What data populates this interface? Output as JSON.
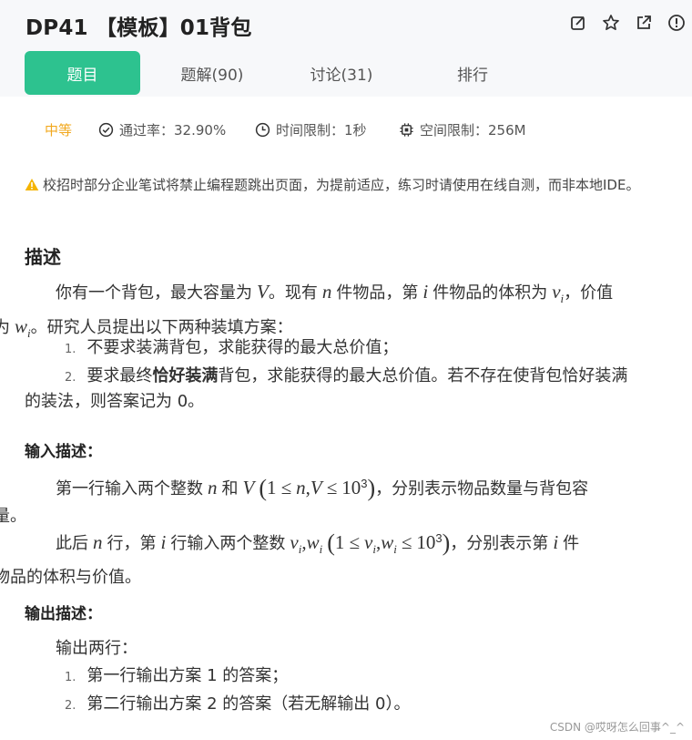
{
  "header": {
    "title": "DP41 【模板】01背包",
    "icons": [
      "edit-icon",
      "star-icon",
      "share-icon",
      "report-icon"
    ]
  },
  "tabs": [
    {
      "label": "题目",
      "active": true
    },
    {
      "label": "题解(90)",
      "active": false
    },
    {
      "label": "讨论(31)",
      "active": false
    },
    {
      "label": "排行",
      "active": false
    }
  ],
  "stats": {
    "difficulty": "中等",
    "pass_rate": "通过率：32.90%",
    "time_limit": "时间限制：1秒",
    "memory_limit": "空间限制：256M"
  },
  "colors": {
    "accent": "#2dc28f",
    "difficulty": "#f2a81d",
    "warn": "#f5b400"
  },
  "warning": "校招时部分企业笔试将禁止编程题跳出页面，为提前适应，练习时请使用在线自测，而非本地IDE。",
  "description": {
    "heading": "描述",
    "p1a": "你有一个背包，最大容量为 ",
    "var_V": "V",
    "p1b": "。现有 ",
    "var_n": "n",
    "p1c": " 件物品，第 ",
    "var_i": "i",
    "p1d": " 件物品的体积为 ",
    "var_vi": "v",
    "p1e": "，价值",
    "p1f": "为 ",
    "var_wi": "w",
    "p1g": "。研究人员提出以下两种装填方案：",
    "sub_i": "i",
    "list": [
      {
        "num": "1.",
        "text": "不要求装满背包，求能获得的最大总价值；"
      },
      {
        "num": "2.",
        "text_a": "要求最终",
        "bold": "恰好装满",
        "text_b": "背包，求能获得的最大总价值。若不存在使背包恰好装满"
      }
    ],
    "list_cont": "的装法，则答案记为 0。"
  },
  "input": {
    "heading": "输入描述：",
    "l1a": "第一行输入两个整数 ",
    "l1b": " 和 ",
    "l1c": "，分别表示物品数量与背包容",
    "l1d": "量。",
    "l2a": "此后 ",
    "l2b": " 行，第 ",
    "l2c": " 行输入两个整数 ",
    "l2d": "，分别表示第 ",
    "l2e": " 件",
    "l2f": "物品的体积与价值。",
    "cons_le": "≤",
    "cons_one": "1",
    "cons_ten": "10",
    "cons_exp": "3",
    "comma": ","
  },
  "output": {
    "heading": "输出描述：",
    "intro": "输出两行：",
    "list": [
      {
        "num": "1.",
        "text": "第一行输出方案 1 的答案；"
      },
      {
        "num": "2.",
        "text": "第二行输出方案 2 的答案（若无解输出 0）。"
      }
    ]
  },
  "footer": "CSDN @哎呀怎么回事^_^"
}
